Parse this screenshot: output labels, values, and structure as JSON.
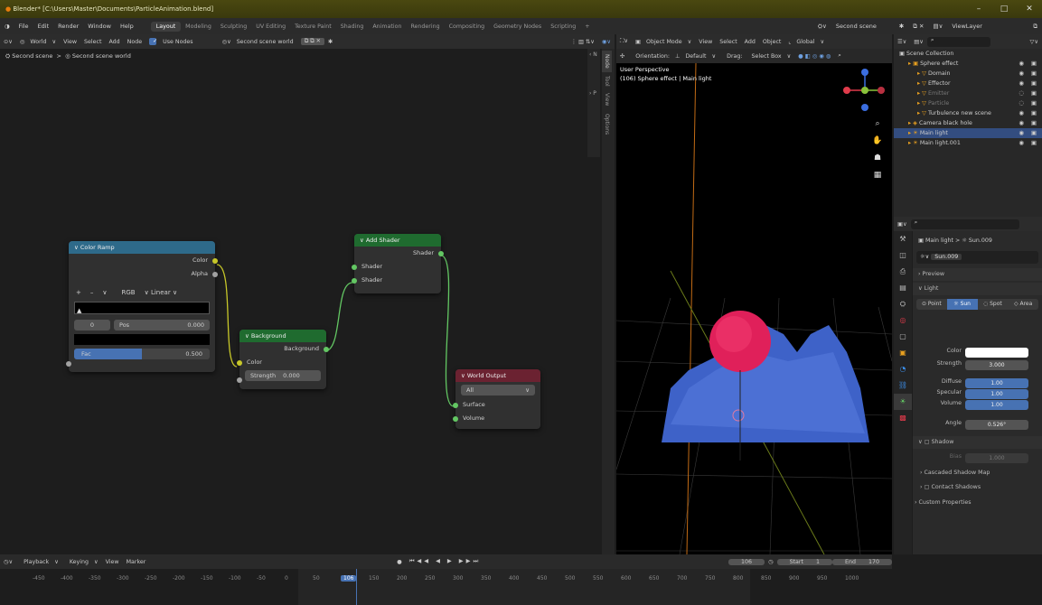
{
  "window": {
    "title": "Blender* [C:\\Users\\Master\\Documents\\ParticleAnimation.blend]",
    "controls": [
      "–",
      "□",
      "✕"
    ]
  },
  "menu": [
    "File",
    "Edit",
    "Render",
    "Window",
    "Help"
  ],
  "workspaces": [
    "Layout",
    "Modeling",
    "Sculpting",
    "UV Editing",
    "Texture Paint",
    "Shading",
    "Animation",
    "Rendering",
    "Compositing",
    "Geometry Nodes",
    "Scripting",
    "+"
  ],
  "active_workspace": "Layout",
  "scene": {
    "name": "Second scene",
    "view_layer": "ViewLayer"
  },
  "node_editor": {
    "shader_type": "World",
    "menus": [
      "View",
      "Select",
      "Add",
      "Node"
    ],
    "use_nodes_label": "Use Nodes",
    "world_name": "Second scene world",
    "breadcrumb": [
      "Second scene",
      "Second scene world"
    ],
    "side_tabs": [
      "Node",
      "Tool",
      "View",
      "Options"
    ],
    "nodes": {
      "color_ramp": {
        "title": "Color Ramp",
        "out_color": "Color",
        "out_alpha": "Alpha",
        "mode": "RGB",
        "interp": "Linear",
        "index": "0",
        "pos_label": "Pos",
        "pos_value": "0.000",
        "fac_label": "Fac",
        "fac_value": "0.500",
        "fac_fraction": 0.5,
        "controls": [
          "+",
          "–",
          "∨"
        ]
      },
      "background": {
        "title": "Background",
        "out": "Background",
        "in_color": "Color",
        "strength_label": "Strength",
        "strength_value": "0.000"
      },
      "add_shader": {
        "title": "Add Shader",
        "out": "Shader",
        "in1": "Shader",
        "in2": "Shader"
      },
      "world_output": {
        "title": "World Output",
        "target": "All",
        "in_surface": "Surface",
        "in_volume": "Volume"
      }
    },
    "colors": {
      "input_header": "#2e6a8a",
      "shader_header": "#1f6b2f",
      "output_header": "#6b2231"
    }
  },
  "viewport": {
    "mode": "Object Mode",
    "menus": [
      "View",
      "Select",
      "Add",
      "Object"
    ],
    "orientation_label": "Orientation:",
    "orientation": "Default",
    "drag_label": "Drag:",
    "drag": "Select Box",
    "transform": "Global",
    "overlay_title": "User Perspective",
    "overlay_sub": "(106) Sphere effect | Main light"
  },
  "outliner": {
    "search_placeholder": "",
    "root": "Scene Collection",
    "items": [
      {
        "name": "Sphere effect",
        "level": 1,
        "selected": false,
        "dim": false
      },
      {
        "name": "Domain",
        "level": 2,
        "selected": false,
        "dim": false
      },
      {
        "name": "Effector",
        "level": 2,
        "selected": false,
        "dim": false
      },
      {
        "name": "Emitter",
        "level": 2,
        "selected": false,
        "dim": true
      },
      {
        "name": "Particle",
        "level": 2,
        "selected": false,
        "dim": true
      },
      {
        "name": "Turbulence new scene",
        "level": 2,
        "selected": false,
        "dim": false
      },
      {
        "name": "Camera black hole",
        "level": 1,
        "selected": false,
        "dim": false
      },
      {
        "name": "Main light",
        "level": 1,
        "selected": true,
        "dim": false
      },
      {
        "name": "Main light.001",
        "level": 1,
        "selected": false,
        "dim": false
      }
    ]
  },
  "properties": {
    "breadcrumb": [
      "Main light",
      "Sun.009"
    ],
    "datablock": "Sun.009",
    "panels": {
      "preview": "Preview",
      "light": "Light",
      "shadow": "Shadow",
      "cascaded": "Cascaded Shadow Map",
      "contact": "Contact Shadows",
      "custom": "Custom Properties"
    },
    "light_types": [
      "Point",
      "Sun",
      "Spot",
      "Area"
    ],
    "active_type": "Sun",
    "fields": [
      {
        "label": "Color",
        "value": ""
      },
      {
        "label": "Strength",
        "value": "3.000"
      },
      {
        "label": "Diffuse",
        "value": "1.00"
      },
      {
        "label": "Specular",
        "value": "1.00"
      },
      {
        "label": "Volume",
        "value": "1.00"
      },
      {
        "label": "Angle",
        "value": "0.526°"
      }
    ],
    "bias_label": "Bias",
    "bias_value": "1.000"
  },
  "timeline": {
    "menus": [
      "Playback",
      "Keying",
      "View",
      "Marker"
    ],
    "current_frame": "106",
    "start_label": "Start",
    "start": "1",
    "end_label": "End",
    "end": "170",
    "ruler": [
      "-450",
      "-400",
      "-350",
      "-300",
      "-250",
      "-200",
      "-150",
      "-100",
      "-50",
      "0",
      "50",
      "106",
      "150",
      "200",
      "250",
      "300",
      "350",
      "400",
      "450",
      "500",
      "550",
      "600",
      "650",
      "700",
      "750",
      "800",
      "850",
      "900",
      "950",
      "1000"
    ]
  }
}
